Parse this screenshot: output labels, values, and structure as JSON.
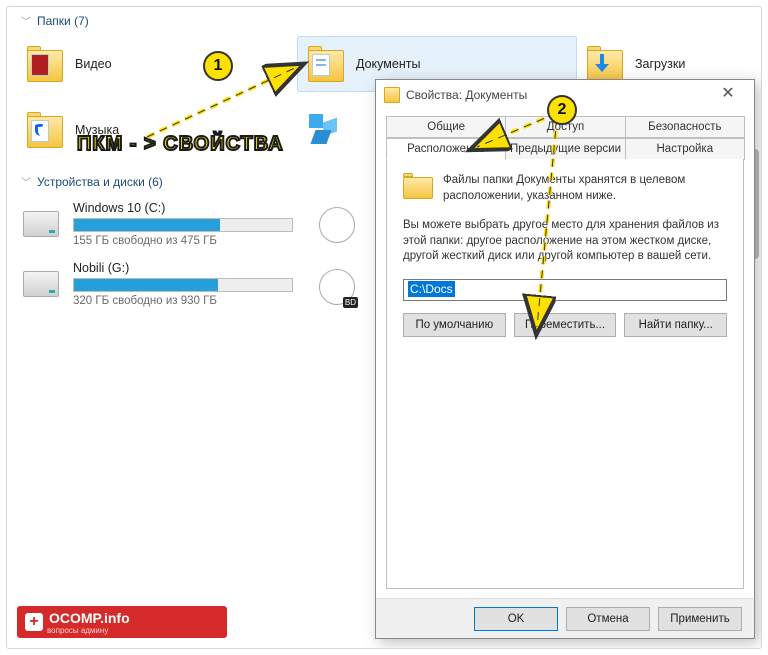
{
  "sections": {
    "folders_header": "Папки (7)",
    "drives_header": "Устройства и диски (6)"
  },
  "folders": {
    "video": "Видео",
    "documents": "Документы",
    "downloads": "Загрузки",
    "music": "Музыка"
  },
  "drives": {
    "c": {
      "name": "Windows 10 (C:)",
      "sub": "155 ГБ свободно из 475 ГБ",
      "fill_pct": 67
    },
    "g": {
      "name": "Nobili (G:)",
      "sub": "320 ГБ свободно из 930 ГБ",
      "fill_pct": 66
    }
  },
  "dialog": {
    "title": "Свойства: Документы",
    "tabs_row1": {
      "general": "Общие",
      "access": "Доступ",
      "security": "Безопасность"
    },
    "tabs_row2": {
      "location": "Расположение",
      "prev": "Предыдущие версии",
      "custom": "Настройка"
    },
    "text1": "Файлы папки Документы хранятся в целевом расположении, указанном ниже.",
    "text2": "Вы можете выбрать другое место для хранения файлов из этой папки: другое расположение на этом жестком диске, другой жесткий диск или другой компьютер в вашей сети.",
    "path_value": "C:\\Docs",
    "btn_default": "По умолчанию",
    "btn_move": "Переместить...",
    "btn_find": "Найти папку...",
    "btn_ok": "OK",
    "btn_cancel": "Отмена",
    "btn_apply": "Применить"
  },
  "annotations": {
    "b1": "1",
    "b2": "2",
    "hint": "ПКМ - > СВОЙСТВА"
  },
  "watermark": {
    "main": "OCOMP.info",
    "sub": "вопросы админу"
  }
}
